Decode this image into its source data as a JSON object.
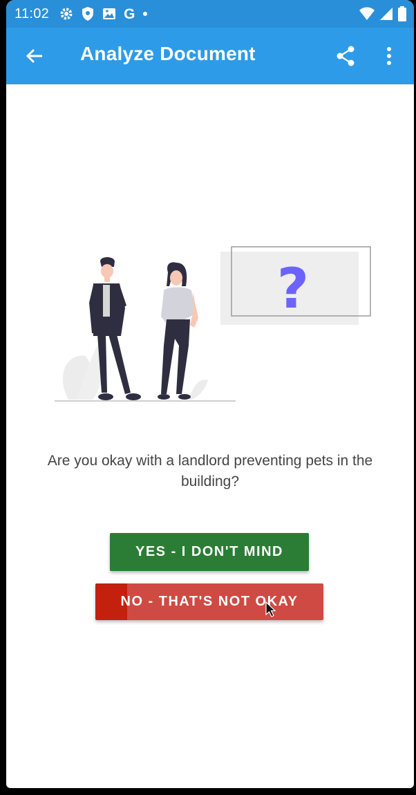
{
  "status_bar": {
    "time": "11:02",
    "notification_icons": [
      "settings-icon",
      "shield-icon",
      "photo-icon",
      "google-icon",
      "dot-icon"
    ],
    "google_glyph": "G",
    "right_icons": [
      "wifi-icon",
      "signal-icon",
      "battery-icon"
    ]
  },
  "appbar": {
    "title": "Analyze Document",
    "back_icon": "arrow-back-icon",
    "share_icon": "share-icon",
    "more_icon": "more-vert-icon"
  },
  "question": "Are you okay with a landlord preventing pets in the building?",
  "buttons": {
    "yes_label": "YES - I DON'T MIND",
    "no_label": "NO - THAT'S NOT OKAY"
  },
  "colors": {
    "status_bar": "#2a8fd9",
    "app_bar": "#2d9be8",
    "yes_button": "#2b7d35",
    "no_button": "#cf4a43",
    "no_button_press": "#c4200e",
    "question_mark": "#6c63ff"
  },
  "illustration": {
    "icon": "people-question-illustration",
    "glyph": "?"
  }
}
